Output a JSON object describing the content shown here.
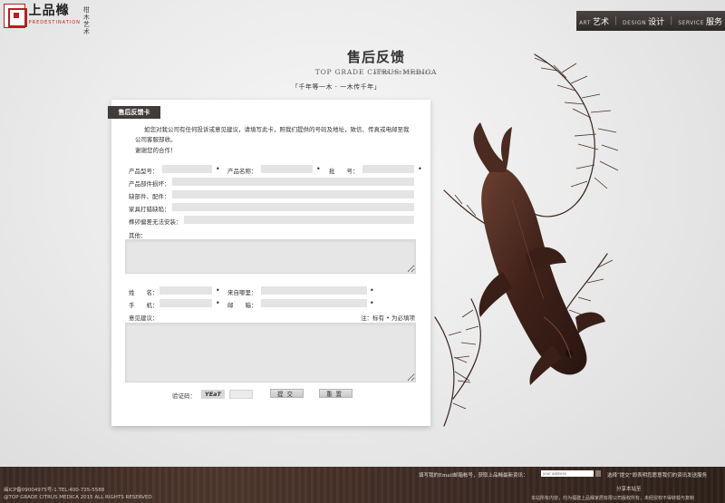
{
  "header": {
    "logo_cn": "上品橼",
    "logo_en": "PREDESTINATION",
    "logo_side": "柑木艺术",
    "nav": [
      {
        "en": "ART",
        "cn": "艺术"
      },
      {
        "en": "DESIGN",
        "cn": "设计"
      },
      {
        "en": "SERVICE",
        "cn": "服务"
      }
    ]
  },
  "title": {
    "cn": "售后反馈",
    "en": "TOP GRADE CITRUS MEDICA",
    "sub": "AFTER THE FEEDBACK",
    "motto": "「千年等一木 · 一木传千年」"
  },
  "form": {
    "tab": "售后反馈卡",
    "intro": "如您对我公司有任何投诉或意见建议，请填写此卡，照我们提供的号码及地址，致信、传真或电邮至我公司客服部收。",
    "thanks": "谢谢您的合作！",
    "labels": {
      "model": "产品型号：",
      "name": "产品名称：",
      "batch": "批　　号：",
      "damage": "产品部件损坏：",
      "missing": "缺部件、配件：",
      "furniture": "家具打蜡缺陷：",
      "install": "榫卯偏差无法安装：",
      "other": "其他：",
      "person": "姓　　名：",
      "from": "来自哪里：",
      "phone": "手　　机：",
      "email": "邮　　箱：",
      "suggestion": "意见建议：",
      "note": "注：标有 • 为必填项",
      "captcha_label": "验证码："
    },
    "required_mark": "•",
    "captcha": "YEaT",
    "submit": "提交",
    "reset": "重置"
  },
  "footer": {
    "icp": "闽ICP备09004975号-1  TEL:400-735-5588",
    "rights": "@TOP GRADE CITRUS MEDICA 2015 ALL RIGHTS RESERVED",
    "subscribe_label": "填写我的Email邮箱帐号，获取上品橼最新资讯：",
    "email_placeholder": "your address",
    "subscribe_note": "选择“提交”即表明您愿意我们的资讯发送服务",
    "share": "分享本站至",
    "copyright": "本站所有内容，均为福建上品橼家居有限公司版权所有，未经授权不得转载与复制"
  }
}
